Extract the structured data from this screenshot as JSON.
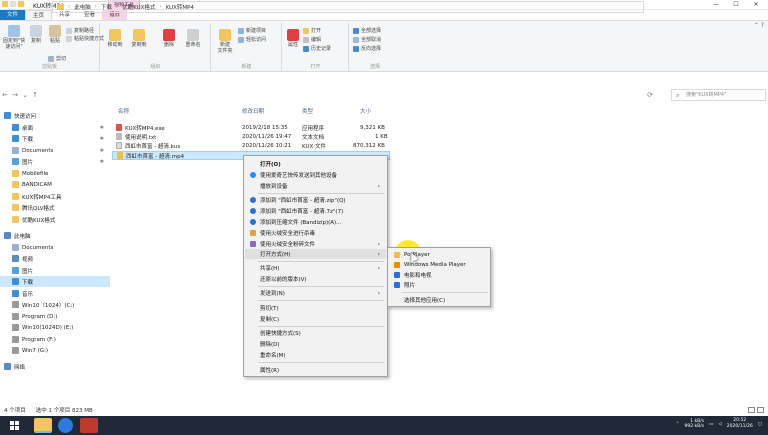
{
  "window": {
    "title": "KUX转MP4",
    "context_tab_header": "视频工具",
    "controls": [
      "minimize",
      "maximize",
      "close"
    ]
  },
  "ribbon": {
    "tabs": [
      "文件",
      "主页",
      "共享",
      "查看",
      "播放"
    ],
    "groups": {
      "clipboard": {
        "label": "剪贴板",
        "pin_quick": "固定到\"快\n速访问\"",
        "copy": "复制",
        "paste": "粘贴",
        "copy_path": "复制路径",
        "paste_shortcut": "粘贴快捷方式",
        "cut": "剪切"
      },
      "organize": {
        "label": "组织",
        "move_to": "移动到",
        "copy_to": "复制到",
        "delete": "删除",
        "rename": "重命名"
      },
      "new": {
        "label": "新建",
        "new_folder": "新建\n文件夹",
        "new_item": "新建项目",
        "easy_access": "轻松访问"
      },
      "open": {
        "label": "打开",
        "properties": "属性",
        "open": "打开",
        "edit": "编辑",
        "history": "历史记录"
      },
      "select": {
        "label": "选择",
        "select_all": "全部选择",
        "select_none": "全部取消",
        "invert": "反向选择"
      }
    }
  },
  "address": {
    "path": [
      "此电脑",
      "下载",
      "优酷KUX格式",
      "KUX转MP4"
    ],
    "search_placeholder": "搜索\"KUX转MP4\""
  },
  "nav": {
    "items": [
      {
        "label": "快速访问",
        "pinned": false
      },
      {
        "label": "桌面",
        "pinned": true
      },
      {
        "label": "下载",
        "pinned": true
      },
      {
        "label": "Documents",
        "pinned": true
      },
      {
        "label": "图片",
        "pinned": true
      },
      {
        "label": "Mobilefile",
        "pinned": false
      },
      {
        "label": "BANDICAM",
        "pinned": false
      },
      {
        "label": "KUX转MP4工具",
        "pinned": false
      },
      {
        "label": "腾讯QLV格式",
        "pinned": false
      },
      {
        "label": "优酷KUX格式",
        "pinned": false
      },
      {
        "label": "此电脑",
        "pinned": false
      },
      {
        "label": "Documents",
        "pinned": false
      },
      {
        "label": "视频",
        "pinned": false
      },
      {
        "label": "图片",
        "pinned": false
      },
      {
        "label": "下载",
        "pinned": false
      },
      {
        "label": "音乐",
        "pinned": false
      },
      {
        "label": "Win10（1024）(C:)",
        "pinned": false
      },
      {
        "label": "Program (D:)",
        "pinned": false
      },
      {
        "label": "Win10(1024D) (E:)",
        "pinned": false
      },
      {
        "label": "Program (F:)",
        "pinned": false
      },
      {
        "label": "Win7 (G:)",
        "pinned": false
      },
      {
        "label": "网络",
        "pinned": false
      }
    ]
  },
  "files": {
    "columns": [
      "名称",
      "修改日期",
      "类型",
      "大小"
    ],
    "rows": [
      {
        "name": "KUX转MP4.exe",
        "date": "2019/2/18 15:35",
        "type": "应用程序",
        "size": "9,321 KB",
        "selected": false,
        "color": "#d9534f"
      },
      {
        "name": "使用说明.txt",
        "date": "2020/11/26 19:47",
        "type": "文本文档",
        "size": "1 KB",
        "selected": false,
        "color": "#888888"
      },
      {
        "name": "西虹市首富 - 超清.kux",
        "date": "2020/11/26 10:21",
        "type": "KUX 文件",
        "size": "870,312 KB",
        "selected": false,
        "color": "#cccccc"
      },
      {
        "name": "西虹市首富 - 超清.mp4",
        "date": "",
        "type": "",
        "size": "",
        "selected": true,
        "color": "#f0c040"
      }
    ]
  },
  "context_menu": {
    "items": [
      {
        "label": "打开(O)",
        "bold": true,
        "icon": "",
        "arrow": false
      },
      {
        "label": "使用爱奇艺快传发送到其他设备",
        "icon": "#1e90ff",
        "arrow": false
      },
      {
        "label": "播放到设备",
        "icon": "",
        "arrow": true
      },
      {
        "label": "添加到 \"西虹市首富 - 超清.zip\"(Q)",
        "icon": "#2a6fd6",
        "arrow": false
      },
      {
        "label": "添加到 \"西虹市首富 - 超清.7z\"(7)",
        "icon": "#2a6fd6",
        "arrow": false
      },
      {
        "label": "添加到压缩文件 (Bandizip)(A)...",
        "icon": "#2a6fd6",
        "arrow": false
      },
      {
        "label": "使用火绒安全进行杀毒",
        "icon": "#e8a23a",
        "arrow": false
      },
      {
        "label": "使用火绒安全粉碎文件",
        "icon": "#8e6bc4",
        "arrow": true
      },
      {
        "label": "打开方式(H)",
        "icon": "",
        "arrow": true,
        "hover": true
      },
      {
        "label": "共享(H)",
        "icon": "",
        "arrow": true
      },
      {
        "label": "还原以前的版本(V)",
        "icon": "",
        "arrow": false
      },
      {
        "label": "发送到(N)",
        "icon": "",
        "arrow": true
      },
      {
        "label": "剪切(T)",
        "icon": "",
        "arrow": false
      },
      {
        "label": "复制(C)",
        "icon": "",
        "arrow": false
      },
      {
        "label": "创建快捷方式(S)",
        "icon": "",
        "arrow": false
      },
      {
        "label": "删除(D)",
        "icon": "",
        "arrow": false
      },
      {
        "label": "重命名(M)",
        "icon": "",
        "arrow": false
      },
      {
        "label": "属性(R)",
        "icon": "",
        "arrow": false
      }
    ]
  },
  "submenu": {
    "items": [
      {
        "label": "PotPlayer",
        "icon": "#f0c040"
      },
      {
        "label": "Windows Media Player",
        "icon": "#f08c00"
      },
      {
        "label": "电影和电视",
        "icon": "#2a6fd6"
      },
      {
        "label": "照片",
        "icon": "#2a6fd6"
      },
      {
        "label": "选择其他应用(C)",
        "icon": ""
      }
    ]
  },
  "status": {
    "item_count": "4 个项目",
    "selected": "选中 1 个项目  823 MB"
  },
  "taskbar": {
    "apps": [
      "file-explorer-icon",
      "potplayer-icon",
      "kux-converter-icon"
    ],
    "net_up": "1 kB/s",
    "net_down": "992 kB/s",
    "time": "20:52",
    "date": "2020/11/26"
  }
}
